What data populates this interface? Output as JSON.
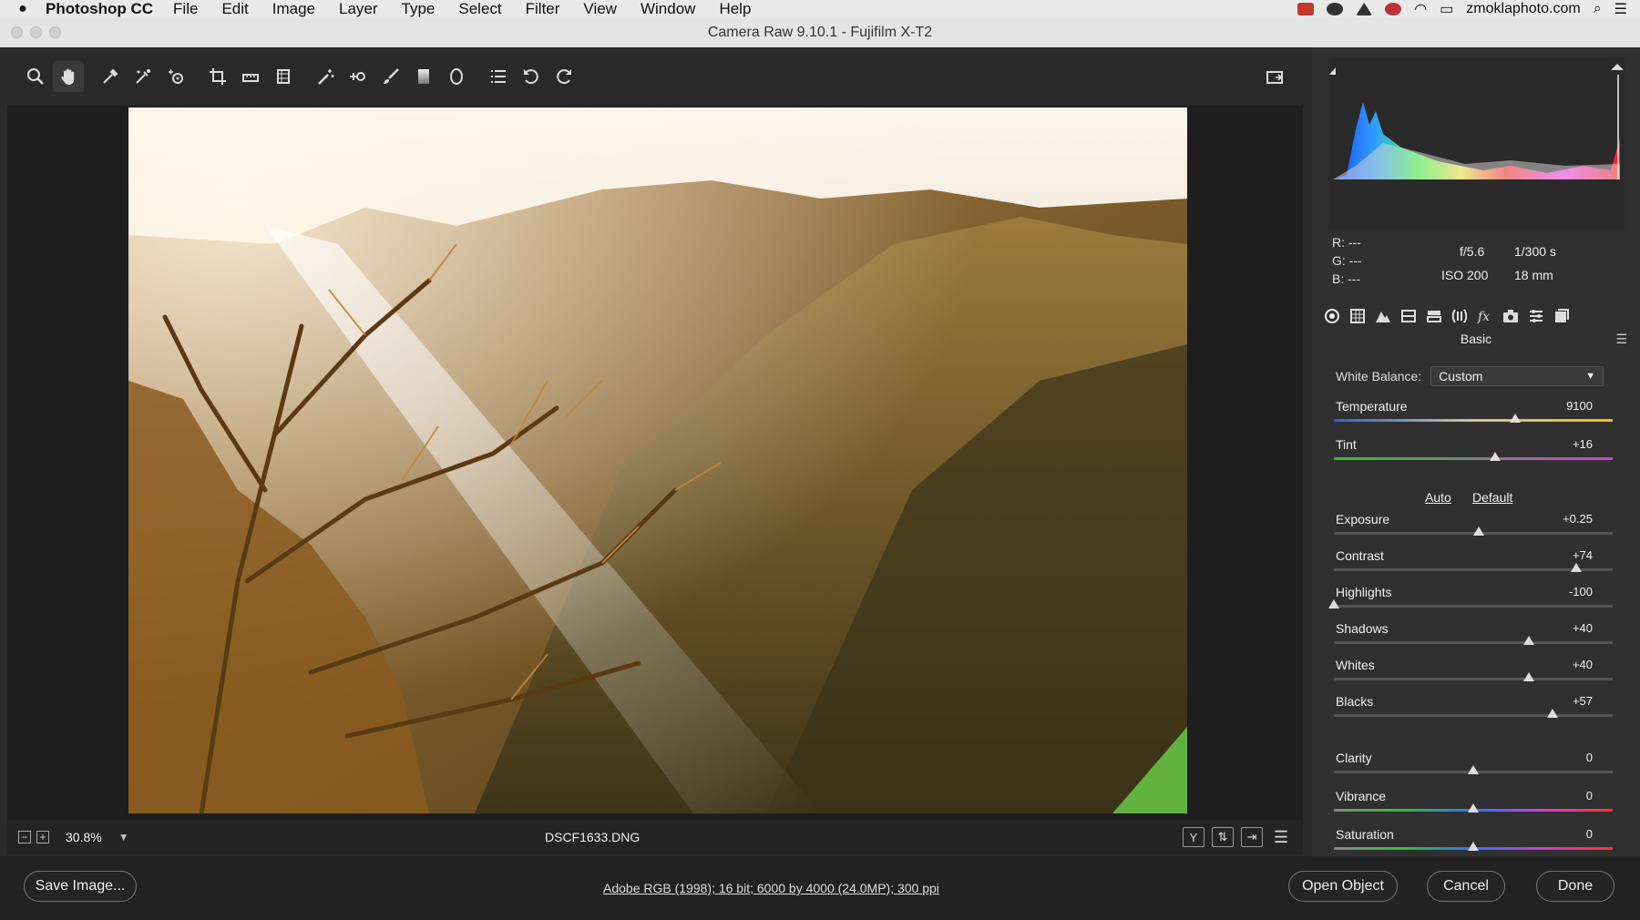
{
  "menubar": {
    "app": "Photoshop CC",
    "items": [
      "File",
      "Edit",
      "Image",
      "Layer",
      "Type",
      "Select",
      "Filter",
      "View",
      "Window",
      "Help"
    ],
    "account": "zmoklaphoto.com"
  },
  "window": {
    "title": "Camera Raw 9.10.1  -  Fujifilm X-T2"
  },
  "status": {
    "zoom": "30.8%",
    "filename": "DSCF1633.DNG"
  },
  "info": {
    "r_label": "R:",
    "r_value": "---",
    "g_label": "G:",
    "g_value": "---",
    "b_label": "B:",
    "b_value": "---",
    "aperture": "f/5.6",
    "shutter": "1/300 s",
    "iso": "ISO 200",
    "focal": "18 mm"
  },
  "panel": {
    "title": "Basic",
    "white_balance_label": "White Balance:",
    "white_balance_value": "Custom",
    "auto_label": "Auto",
    "default_label": "Default",
    "sliders": [
      {
        "label": "Temperature",
        "value": "9100",
        "pos": 0.65,
        "track": "temp"
      },
      {
        "label": "Tint",
        "value": "+16",
        "pos": 0.58,
        "track": "tint"
      },
      {
        "label": "Exposure",
        "value": "+0.25",
        "pos": 0.52,
        "track": "gray"
      },
      {
        "label": "Contrast",
        "value": "+74",
        "pos": 0.87,
        "track": "gray"
      },
      {
        "label": "Highlights",
        "value": "-100",
        "pos": 0.0,
        "track": "gray"
      },
      {
        "label": "Shadows",
        "value": "+40",
        "pos": 0.7,
        "track": "gray"
      },
      {
        "label": "Whites",
        "value": "+40",
        "pos": 0.7,
        "track": "gray"
      },
      {
        "label": "Blacks",
        "value": "+57",
        "pos": 0.785,
        "track": "gray"
      },
      {
        "label": "Clarity",
        "value": "0",
        "pos": 0.5,
        "track": "gray"
      },
      {
        "label": "Vibrance",
        "value": "0",
        "pos": 0.5,
        "track": "color"
      },
      {
        "label": "Saturation",
        "value": "0",
        "pos": 0.5,
        "track": "color"
      }
    ]
  },
  "footer": {
    "save_label": "Save Image...",
    "workflow_text": "Adobe RGB (1998); 16 bit; 6000 by 4000 (24.0MP); 300 ppi",
    "open_label": "Open Object",
    "cancel_label": "Cancel",
    "done_label": "Done"
  },
  "colors": {
    "accent": "#e9e9e9",
    "panel": "#303030",
    "preview_bg": "#1e1e1e"
  }
}
